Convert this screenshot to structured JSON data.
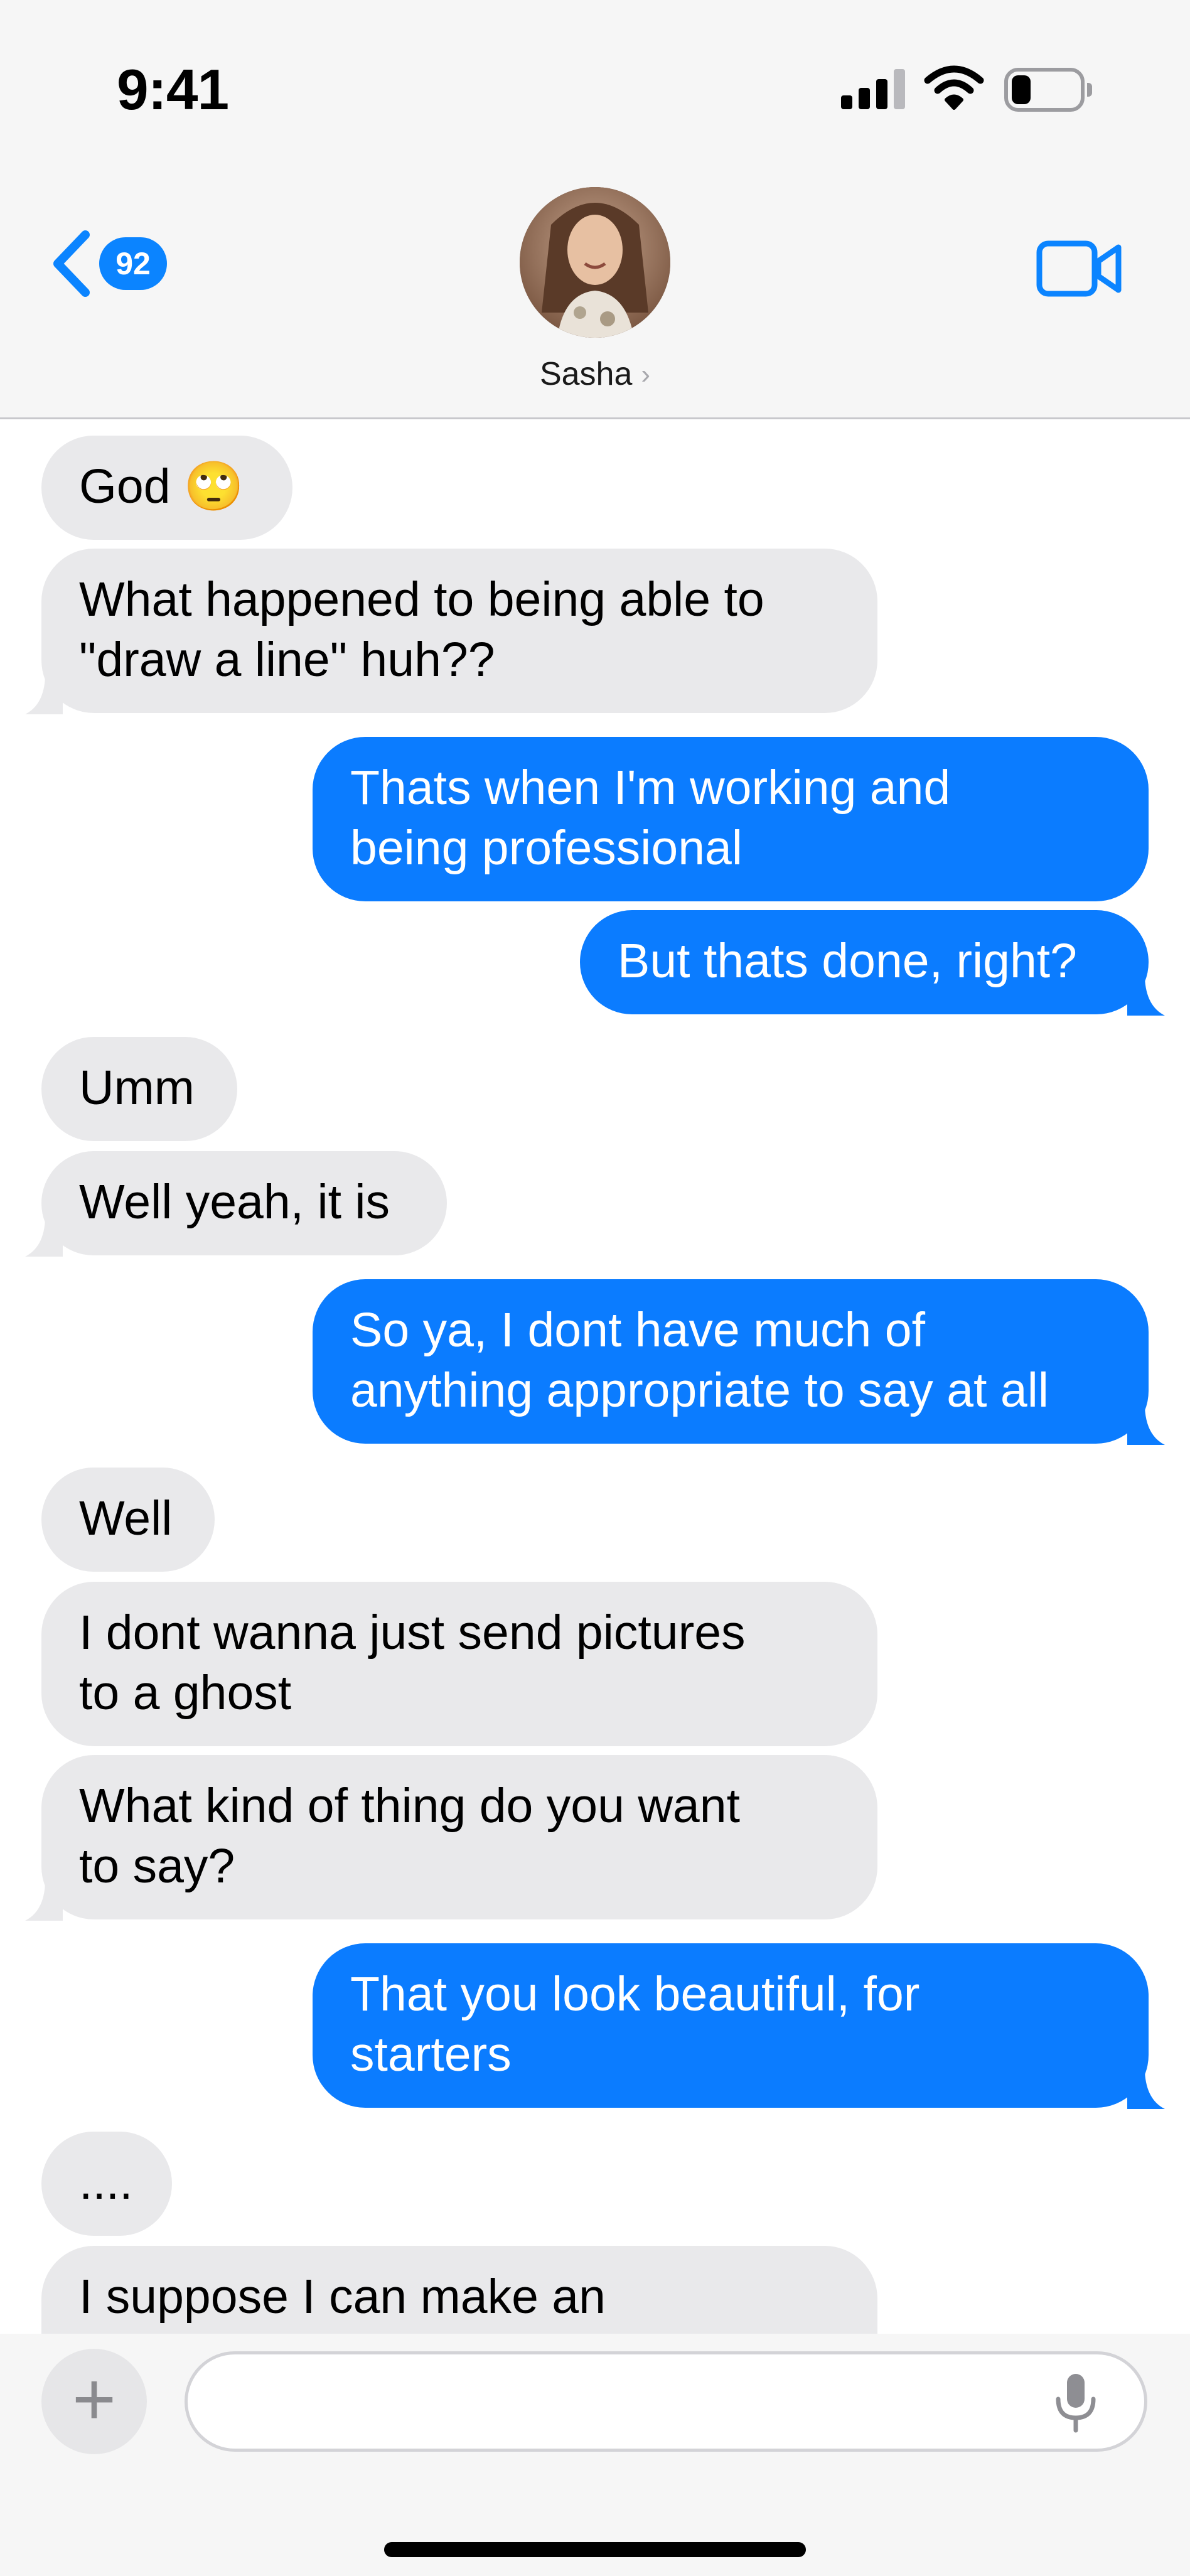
{
  "status_bar": {
    "time": "9:41",
    "icons": [
      "cellular-signal-icon",
      "wifi-icon",
      "battery-icon"
    ]
  },
  "nav": {
    "back_badge_count": "92",
    "contact_name": "Sasha",
    "contact_chevron": "›",
    "icons": [
      "chevron-left-icon",
      "video-camera-icon"
    ]
  },
  "colors": {
    "accent": "#0b84ff",
    "outgoing_bubble": "#0b7cff",
    "incoming_bubble": "#e9e9eb",
    "chrome_background": "#f6f6f6"
  },
  "messages": [
    {
      "direction": "in",
      "text": "God 🙄"
    },
    {
      "direction": "in",
      "text": "What happened to being able to\n\"draw a line\" huh??"
    },
    {
      "direction": "out",
      "text": "Thats when I'm working and\nbeing professional"
    },
    {
      "direction": "out",
      "text": "But thats done, right?"
    },
    {
      "direction": "in",
      "text": "Umm"
    },
    {
      "direction": "in",
      "text": "Well yeah, it is"
    },
    {
      "direction": "out",
      "text": "So ya, I dont have much of\nanything appropriate to say at all"
    },
    {
      "direction": "in",
      "text": "Well"
    },
    {
      "direction": "in",
      "text": "I dont wanna just send pictures\nto a ghost"
    },
    {
      "direction": "in",
      "text": "What kind of thing do you want\nto say?"
    },
    {
      "direction": "out",
      "text": "That you look beautiful, for\nstarters"
    },
    {
      "direction": "in",
      "text": "...."
    },
    {
      "direction": "in",
      "text": "I suppose I can make an"
    }
  ],
  "composer": {
    "add_label": "+",
    "input_value": "",
    "input_placeholder": "",
    "icons": [
      "plus-icon",
      "microphone-icon"
    ]
  }
}
